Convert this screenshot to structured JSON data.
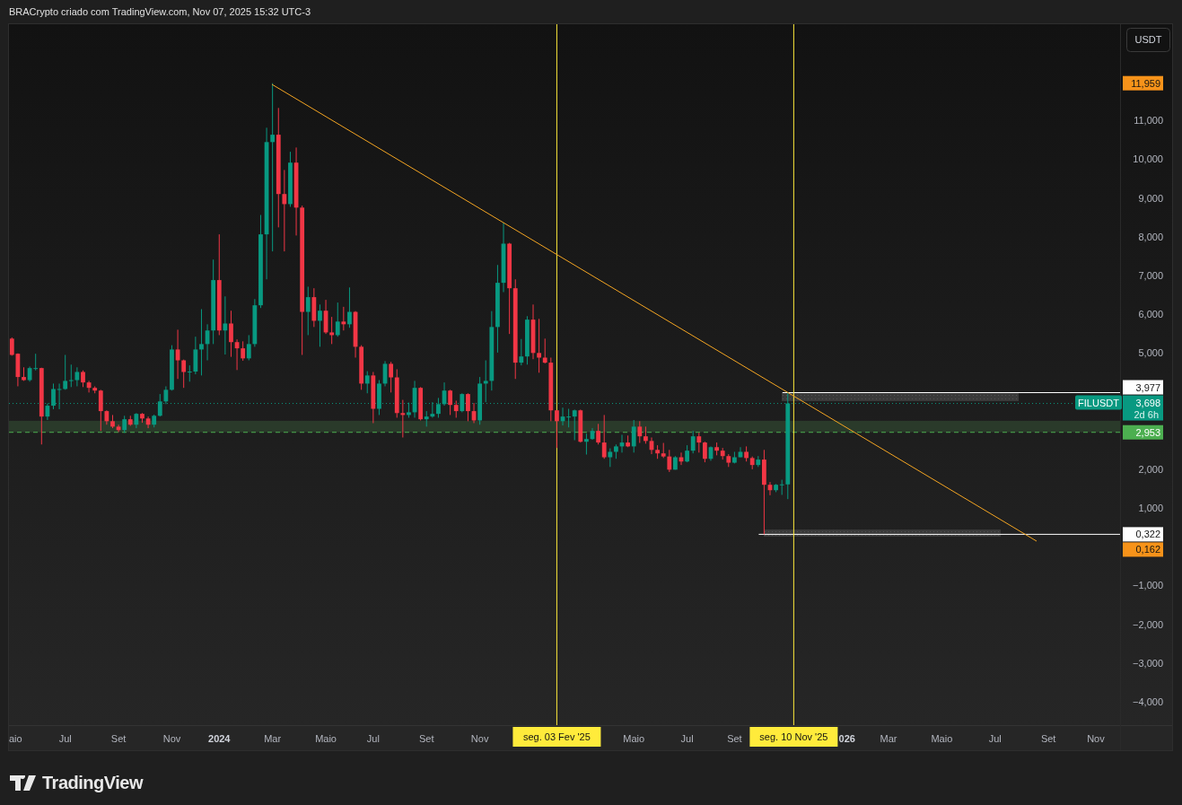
{
  "header": {
    "text": "BRACrypto criado com TradingView.com, Nov 07, 2025 15:32 UTC-3"
  },
  "chart": {
    "currency_button": "USDT",
    "symbol": "FILUSDT",
    "countdown": "2d 6h",
    "chart_data": {
      "type": "candlestick",
      "ylim": [
        -4.6,
        13.48
      ],
      "yticks": [
        {
          "value": 11,
          "label": "11,000"
        },
        {
          "value": 10,
          "label": "10,000"
        },
        {
          "value": 9,
          "label": "9,000"
        },
        {
          "value": 8,
          "label": "8,000"
        },
        {
          "value": 7,
          "label": "7,000"
        },
        {
          "value": 6,
          "label": "6,000"
        },
        {
          "value": 5,
          "label": "5,000"
        },
        {
          "value": 2,
          "label": "2,000"
        },
        {
          "value": 1,
          "label": "1,000"
        },
        {
          "value": -1,
          "label": "−1,000"
        },
        {
          "value": -2,
          "label": "−2,000"
        },
        {
          "value": -3,
          "label": "−3,000"
        },
        {
          "value": -4,
          "label": "−4,000"
        }
      ],
      "categories": [
        "aio",
        null,
        null,
        null,
        null,
        null,
        null,
        null,
        null,
        "Jul",
        null,
        null,
        null,
        null,
        null,
        null,
        null,
        null,
        "Set",
        null,
        null,
        null,
        null,
        null,
        null,
        null,
        null,
        "Nov",
        null,
        null,
        null,
        null,
        null,
        null,
        null,
        "2024",
        null,
        null,
        null,
        null,
        null,
        null,
        null,
        null,
        "Mar",
        null,
        null,
        null,
        null,
        null,
        null,
        null,
        null,
        "Maio",
        null,
        null,
        null,
        null,
        null,
        null,
        null,
        "Jul",
        null,
        null,
        null,
        null,
        null,
        null,
        null,
        null,
        "Set",
        null,
        null,
        null,
        null,
        null,
        null,
        null,
        null,
        "Nov",
        null,
        null,
        null,
        null,
        null,
        null,
        null,
        null,
        null,
        null,
        null,
        null,
        "seg. 03 Fev '25",
        null,
        null,
        null,
        null,
        null,
        null,
        null,
        null,
        null,
        null,
        null,
        null,
        "Maio",
        null,
        null,
        null,
        null,
        null,
        null,
        null,
        null,
        "Jul",
        null,
        null,
        null,
        null,
        null,
        null,
        null,
        "Set",
        null,
        null,
        null,
        null,
        null,
        null,
        null,
        null,
        null,
        "seg. 10 Nov '25",
        null,
        null,
        null,
        null,
        null,
        null,
        null,
        null,
        "026",
        null,
        null,
        null,
        null,
        null,
        null,
        "Mar",
        null,
        null,
        null,
        null,
        null,
        null,
        null,
        null,
        "Maio",
        null,
        null,
        null,
        null,
        null,
        null,
        null,
        null,
        "Jul",
        null,
        null,
        null,
        null,
        null,
        null,
        null,
        null,
        "Set",
        null,
        null,
        null,
        null,
        null,
        null,
        null,
        "Nov",
        null
      ],
      "ohlc": [
        [
          5.37,
          5.4,
          4.93,
          4.95
        ],
        [
          4.98,
          4.99,
          4.14,
          4.38
        ],
        [
          4.38,
          4.63,
          4.28,
          4.3
        ],
        [
          4.3,
          4.65,
          4.26,
          4.61
        ],
        [
          4.61,
          4.98,
          4.55,
          4.61
        ],
        [
          4.61,
          4.62,
          2.64,
          3.36
        ],
        [
          3.36,
          3.7,
          3.27,
          3.64
        ],
        [
          3.64,
          4.21,
          3.55,
          4.07
        ],
        [
          4.07,
          4.21,
          3.55,
          4.07
        ],
        [
          4.07,
          4.95,
          4.05,
          4.28
        ],
        [
          4.28,
          4.7,
          4.12,
          4.3
        ],
        [
          4.3,
          4.63,
          4.14,
          4.51
        ],
        [
          4.51,
          4.55,
          4.12,
          4.24
        ],
        [
          4.24,
          4.28,
          3.98,
          4.1
        ],
        [
          4.1,
          4.14,
          3.96,
          4.03
        ],
        [
          4.03,
          4.05,
          2.99,
          3.5
        ],
        [
          3.5,
          3.52,
          3.15,
          3.24
        ],
        [
          3.24,
          3.4,
          3.06,
          3.1
        ],
        [
          3.1,
          3.15,
          2.96,
          3.01
        ],
        [
          3.01,
          3.38,
          2.94,
          3.29
        ],
        [
          3.29,
          3.38,
          3.12,
          3.15
        ],
        [
          3.15,
          3.45,
          3.06,
          3.43
        ],
        [
          3.43,
          3.45,
          3.2,
          3.31
        ],
        [
          3.31,
          3.36,
          3.06,
          3.15
        ],
        [
          3.15,
          3.41,
          3.08,
          3.38
        ],
        [
          3.38,
          3.94,
          3.36,
          3.75
        ],
        [
          3.75,
          4.14,
          3.68,
          4.05
        ],
        [
          4.05,
          5.2,
          4.03,
          5.09
        ],
        [
          5.09,
          5.6,
          4.33,
          4.81
        ],
        [
          4.81,
          4.83,
          4.1,
          4.51
        ],
        [
          4.51,
          4.68,
          4.26,
          4.52
        ],
        [
          4.52,
          5.42,
          4.45,
          5.09
        ],
        [
          5.09,
          6.13,
          4.42,
          5.23
        ],
        [
          5.23,
          5.74,
          4.81,
          5.58
        ],
        [
          5.58,
          7.41,
          5.23,
          6.88
        ],
        [
          6.88,
          8.06,
          5.46,
          5.58
        ],
        [
          5.58,
          6.46,
          4.96,
          5.76
        ],
        [
          5.76,
          6.09,
          4.9,
          5.28
        ],
        [
          5.28,
          5.35,
          4.56,
          5.12
        ],
        [
          5.12,
          5.3,
          4.8,
          4.86
        ],
        [
          4.86,
          5.46,
          4.81,
          5.23
        ],
        [
          5.23,
          6.39,
          5.16,
          6.23
        ],
        [
          6.23,
          8.56,
          6.16,
          8.06
        ],
        [
          8.06,
          10.81,
          6.9,
          10.44
        ],
        [
          10.44,
          11.959,
          7.62,
          10.63
        ],
        [
          10.63,
          11.32,
          8.24,
          9.1
        ],
        [
          9.1,
          9.72,
          7.62,
          8.84
        ],
        [
          8.84,
          10.19,
          8.77,
          9.91
        ],
        [
          9.91,
          10.3,
          8.03,
          8.75
        ],
        [
          8.75,
          8.8,
          4.95,
          6.06
        ],
        [
          6.06,
          6.71,
          5.46,
          6.44
        ],
        [
          6.44,
          6.67,
          5.67,
          5.83
        ],
        [
          5.83,
          6.25,
          5.16,
          6.09
        ],
        [
          6.09,
          6.37,
          5.49,
          5.53
        ],
        [
          5.53,
          5.93,
          5.23,
          5.46
        ],
        [
          5.46,
          6.3,
          5.42,
          5.81
        ],
        [
          5.81,
          6.19,
          5.58,
          5.74
        ],
        [
          5.74,
          6.69,
          5.65,
          6.06
        ],
        [
          6.06,
          6.08,
          4.88,
          5.16
        ],
        [
          5.16,
          5.2,
          4.05,
          4.21
        ],
        [
          4.21,
          4.53,
          3.96,
          4.42
        ],
        [
          4.42,
          4.51,
          3.19,
          3.56
        ],
        [
          3.56,
          4.3,
          3.4,
          4.21
        ],
        [
          4.21,
          4.79,
          4.14,
          4.72
        ],
        [
          4.72,
          4.77,
          3.98,
          4.37
        ],
        [
          4.37,
          4.58,
          3.33,
          3.45
        ],
        [
          3.45,
          3.79,
          2.82,
          3.4
        ],
        [
          3.4,
          3.72,
          3.33,
          3.47
        ],
        [
          3.47,
          4.28,
          3.33,
          4.1
        ],
        [
          4.1,
          4.12,
          3.26,
          3.29
        ],
        [
          3.29,
          3.5,
          3.1,
          3.36
        ],
        [
          3.36,
          3.73,
          3.33,
          3.43
        ],
        [
          3.43,
          3.84,
          3.33,
          3.68
        ],
        [
          3.68,
          4.24,
          3.64,
          4.03
        ],
        [
          4.03,
          4.05,
          3.4,
          3.66
        ],
        [
          3.66,
          3.77,
          3.33,
          3.5
        ],
        [
          3.5,
          3.96,
          3.47,
          3.94
        ],
        [
          3.94,
          3.96,
          3.24,
          3.5
        ],
        [
          3.5,
          3.71,
          3.19,
          3.26
        ],
        [
          3.26,
          4.38,
          3.15,
          4.21
        ],
        [
          4.21,
          4.81,
          3.73,
          4.28
        ],
        [
          4.28,
          6.08,
          4.03,
          5.67
        ],
        [
          5.67,
          7.27,
          5.01,
          6.81
        ],
        [
          6.81,
          8.36,
          6.57,
          7.82
        ],
        [
          7.82,
          7.84,
          5.49,
          6.67
        ],
        [
          6.67,
          6.9,
          4.33,
          4.75
        ],
        [
          4.75,
          5.36,
          4.68,
          4.91
        ],
        [
          4.91,
          5.95,
          4.7,
          5.86
        ],
        [
          5.86,
          6.25,
          4.84,
          5.0
        ],
        [
          5.0,
          5.88,
          4.49,
          4.88
        ],
        [
          4.88,
          5.37,
          4.73,
          4.75
        ],
        [
          4.75,
          4.88,
          3.24,
          3.52
        ],
        [
          3.52,
          3.52,
          2.55,
          3.24
        ],
        [
          3.24,
          3.59,
          3.13,
          3.36
        ],
        [
          3.36,
          3.56,
          3.08,
          3.36
        ],
        [
          3.36,
          3.54,
          2.75,
          3.52
        ],
        [
          3.52,
          3.54,
          2.69,
          2.71
        ],
        [
          2.71,
          2.92,
          2.38,
          2.78
        ],
        [
          2.78,
          3.06,
          2.76,
          2.99
        ],
        [
          2.99,
          3.17,
          2.64,
          2.69
        ],
        [
          2.69,
          3.4,
          2.27,
          2.31
        ],
        [
          2.31,
          2.54,
          2.06,
          2.45
        ],
        [
          2.45,
          2.64,
          2.27,
          2.59
        ],
        [
          2.59,
          2.89,
          2.43,
          2.69
        ],
        [
          2.69,
          2.87,
          2.57,
          2.59
        ],
        [
          2.59,
          3.27,
          2.43,
          3.1
        ],
        [
          3.1,
          3.24,
          2.68,
          2.85
        ],
        [
          2.85,
          3.1,
          2.66,
          2.73
        ],
        [
          2.73,
          2.82,
          2.39,
          2.5
        ],
        [
          2.5,
          2.62,
          2.27,
          2.41
        ],
        [
          2.41,
          2.68,
          2.29,
          2.33
        ],
        [
          2.33,
          2.5,
          1.93,
          1.99
        ],
        [
          1.99,
          2.34,
          1.99,
          2.31
        ],
        [
          2.31,
          2.43,
          2.11,
          2.2
        ],
        [
          2.2,
          2.62,
          2.18,
          2.48
        ],
        [
          2.48,
          2.99,
          2.41,
          2.85
        ],
        [
          2.85,
          2.94,
          2.43,
          2.69
        ],
        [
          2.69,
          2.71,
          2.18,
          2.27
        ],
        [
          2.27,
          2.59,
          2.22,
          2.57
        ],
        [
          2.57,
          2.69,
          2.36,
          2.48
        ],
        [
          2.48,
          2.55,
          2.25,
          2.34
        ],
        [
          2.34,
          2.39,
          2.06,
          2.17
        ],
        [
          2.17,
          2.45,
          2.15,
          2.31
        ],
        [
          2.31,
          2.57,
          2.31,
          2.45
        ],
        [
          2.45,
          2.59,
          2.2,
          2.29
        ],
        [
          2.29,
          2.33,
          2.0,
          2.11
        ],
        [
          2.11,
          2.34,
          2.06,
          2.25
        ],
        [
          2.25,
          2.5,
          0.322,
          1.6
        ],
        [
          1.6,
          1.67,
          1.33,
          1.46
        ],
        [
          1.46,
          1.62,
          1.41,
          1.6
        ],
        [
          1.6,
          1.73,
          1.34,
          1.61
        ],
        [
          1.61,
          3.977,
          1.23,
          3.698
        ],
        null,
        null,
        null,
        null,
        null,
        null,
        null,
        null,
        null,
        null,
        null,
        null,
        null,
        null,
        null,
        null,
        null,
        null,
        null,
        null,
        null,
        null,
        null,
        null,
        null,
        null,
        null,
        null,
        null,
        null,
        null,
        null,
        null,
        null,
        null,
        null,
        null,
        null,
        null,
        null,
        null,
        null,
        null,
        null,
        null,
        null,
        null,
        null,
        null,
        null,
        null,
        null,
        null
      ],
      "bands": [
        {
          "axis": "y",
          "from": 2.953,
          "to": 3.25,
          "color": "#2a3a2a"
        }
      ],
      "ref_lines": [
        {
          "axis": "y",
          "value": 2.953,
          "label": "2,953",
          "color": "#4caf50",
          "line_style": "dashed"
        },
        {
          "axis": "y",
          "value": 3.698,
          "label": "3,698",
          "color": "#089981",
          "line_style": "dotted"
        },
        {
          "axis": "y",
          "value": 3.977,
          "label": "3,977",
          "color": "#ffffff",
          "line_style": "solid"
        },
        {
          "axis": "y",
          "value": 0.322,
          "label": "0,322",
          "color": "#ffffff",
          "line_style": "solid"
        }
      ],
      "annotations": [
        "11,959",
        "0,162"
      ]
    }
  },
  "footer": {
    "logo": "TradingView"
  }
}
